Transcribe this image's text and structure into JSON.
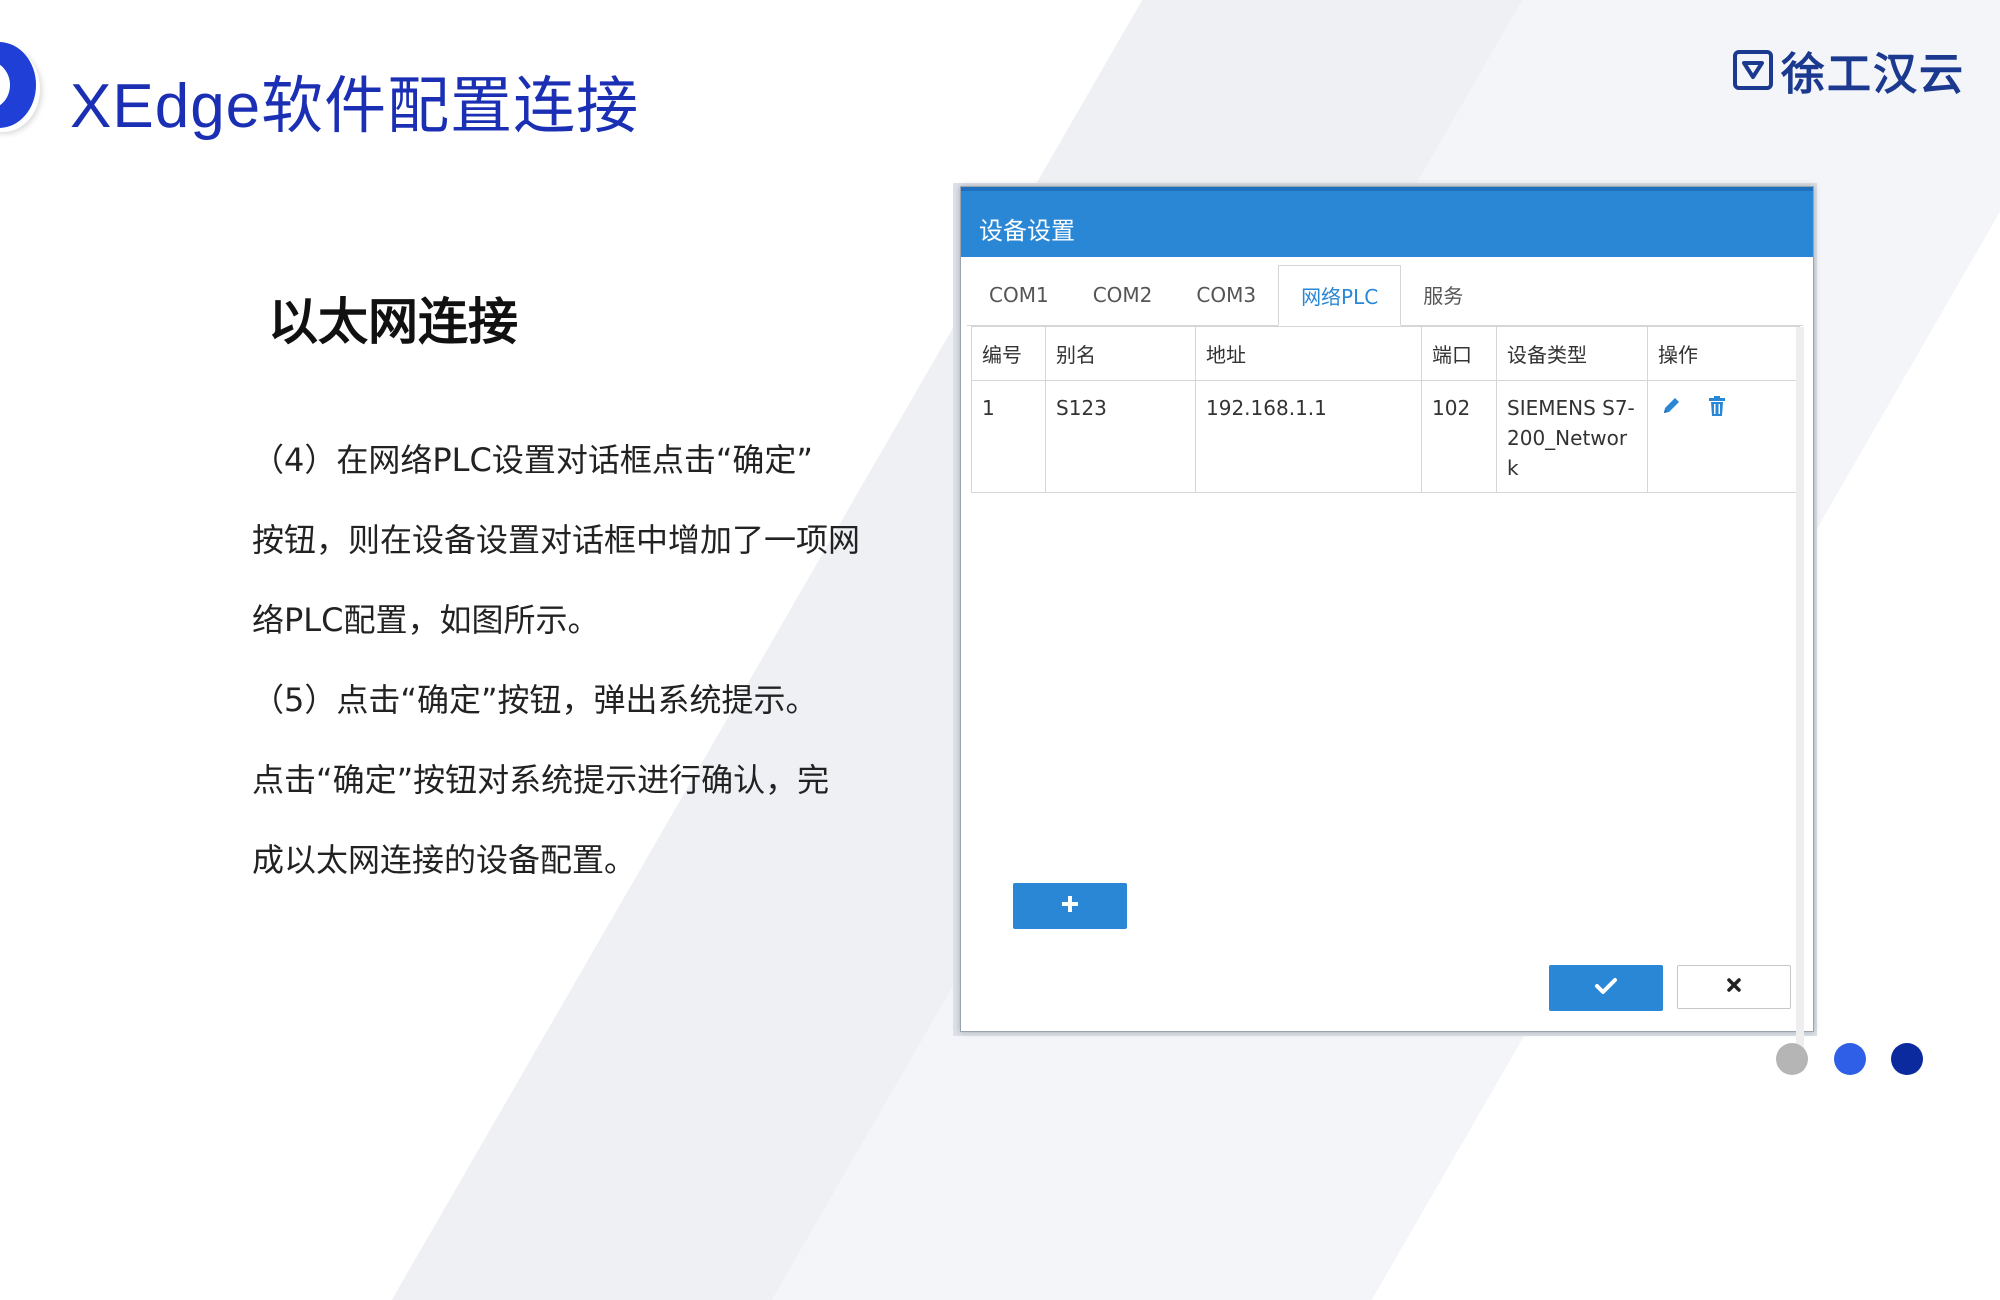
{
  "slide": {
    "title": "XEdge软件配置连接",
    "logo_text": "徐工汉云",
    "section_heading": "以太网连接",
    "paragraph_lines": [
      "（4）在网络PLC设置对话框点击“确定”",
      "按钮，则在设备设置对话框中增加了一项网",
      "络PLC配置，如图所示。",
      "（5）点击“确定”按钮，弹出系统提示。",
      "点击“确定”按钮对系统提示进行确认，完",
      "成以太网连接的设备配置。"
    ],
    "pager": [
      {
        "color": "#b5b5b5"
      },
      {
        "color": "#2f5fe6"
      },
      {
        "color": "#0b2a9e"
      }
    ]
  },
  "dialog": {
    "title": "设备设置",
    "tabs": [
      {
        "label": "COM1",
        "active": false
      },
      {
        "label": "COM2",
        "active": false
      },
      {
        "label": "COM3",
        "active": false
      },
      {
        "label": "网络PLC",
        "active": true
      },
      {
        "label": "服务",
        "active": false
      }
    ],
    "columns": [
      "编号",
      "别名",
      "地址",
      "端口",
      "设备类型",
      "操作"
    ],
    "rows": [
      {
        "id": "1",
        "alias": "S123",
        "address": "192.168.1.1",
        "port": "102",
        "device_type": "SIEMENS S7-200_Network"
      }
    ],
    "add_icon": "plus-icon",
    "confirm_icon": "check-icon",
    "cancel_icon": "close-icon",
    "edit_icon": "pencil-icon",
    "delete_icon": "trash-icon"
  },
  "colors": {
    "accent": "#2a87d6",
    "title_blue": "#1b2fb5",
    "logo_blue": "#1b3a8f"
  }
}
